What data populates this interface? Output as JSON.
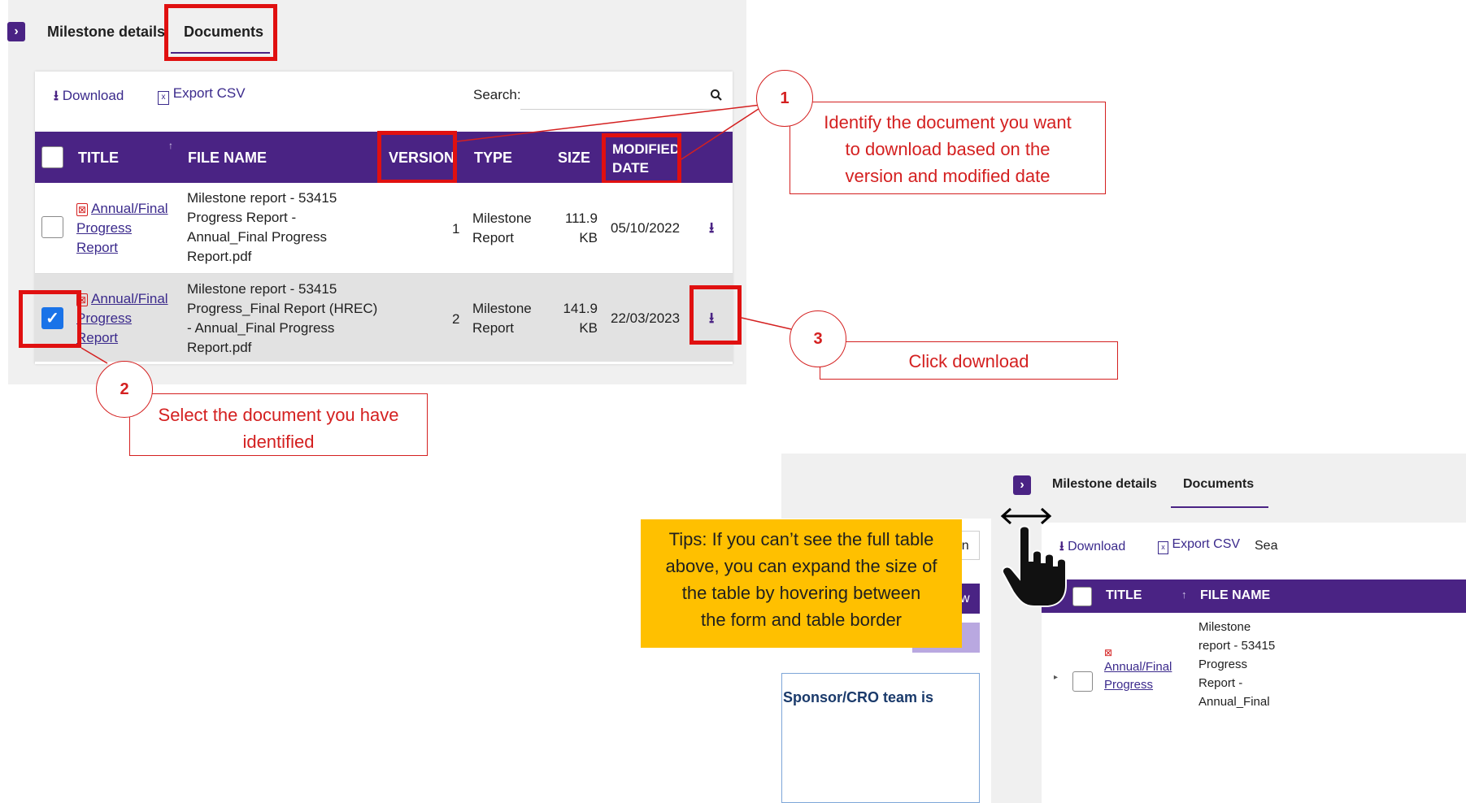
{
  "main": {
    "tabs": [
      "Milestone details",
      "Documents"
    ],
    "toolbar": {
      "download": "Download",
      "export_csv": "Export CSV",
      "search_label": "Search:"
    },
    "columns": [
      "TITLE",
      "FILE NAME",
      "VERSION",
      "TYPE",
      "SIZE",
      "MODIFIED DATE"
    ],
    "modified_line1": "MODIFIED",
    "modified_line2": "DATE",
    "rows": [
      {
        "title_line1": "Annual/Final",
        "title_line2": "Progress",
        "title_line3": "Report",
        "file_line1": "Milestone report - 53415",
        "file_line2": "Progress Report -",
        "file_line3": "Annual_Final Progress",
        "file_line4": "Report.pdf",
        "version": "1",
        "type_line1": "Milestone",
        "type_line2": "Report",
        "size_line1": "111.9",
        "size_line2": "KB",
        "date": "05/10/2022",
        "checked": false
      },
      {
        "title_line1": "Annual/Final",
        "title_line2": "Progress",
        "title_line3": "Report",
        "file_line1": "Milestone report - 53415",
        "file_line2": "Progress_Final Report (HREC)",
        "file_line3": "- Annual_Final Progress",
        "file_line4": "Report.pdf",
        "version": "2",
        "type_line1": "Milestone",
        "type_line2": "Report",
        "size_line1": "141.9",
        "size_line2": "KB",
        "date": "22/03/2023",
        "checked": true
      }
    ]
  },
  "callouts": {
    "c1": {
      "number": "1",
      "line1": "Identify the document you want",
      "line2": "to download based on the",
      "line3": "version and modified date"
    },
    "c2": {
      "number": "2",
      "line1": "Select the document you have",
      "line2": "identified"
    },
    "c3": {
      "number": "3",
      "text": "Click download"
    }
  },
  "tips": {
    "line1": "Tips: If you can’t see the full table",
    "line2": "above, you can expand the size of",
    "line3": "the table by hovering between",
    "line4": "the form and table border"
  },
  "inset": {
    "tabs": [
      "Milestone details",
      "Documents"
    ],
    "download": "Download",
    "export_csv": "Export CSV",
    "search_partial": "Sea",
    "left_partial": "een",
    "left_btn_partial": "w",
    "bottom_partial": "Sponsor/CRO team is",
    "col_title": "TITLE",
    "col_file": "FILE NAME",
    "title_line1": "Annual/Final",
    "title_line2": "Progress",
    "file_line1": "Milestone",
    "file_line2": "report - 53415",
    "file_line3": "Progress",
    "file_line4": "Report -",
    "file_line5": "Annual_Final"
  },
  "icons": [
    "chevron-right-icon",
    "download-icon",
    "csv-file-icon",
    "search-icon",
    "pdf-icon",
    "checkmark-icon",
    "hand-pointer-icon",
    "resize-arrows-icon"
  ],
  "colors": {
    "header_purple": "#4a2384",
    "annotation_red": "#e01010",
    "tips_yellow": "#ffc000",
    "checkbox_blue": "#1a73e8"
  }
}
